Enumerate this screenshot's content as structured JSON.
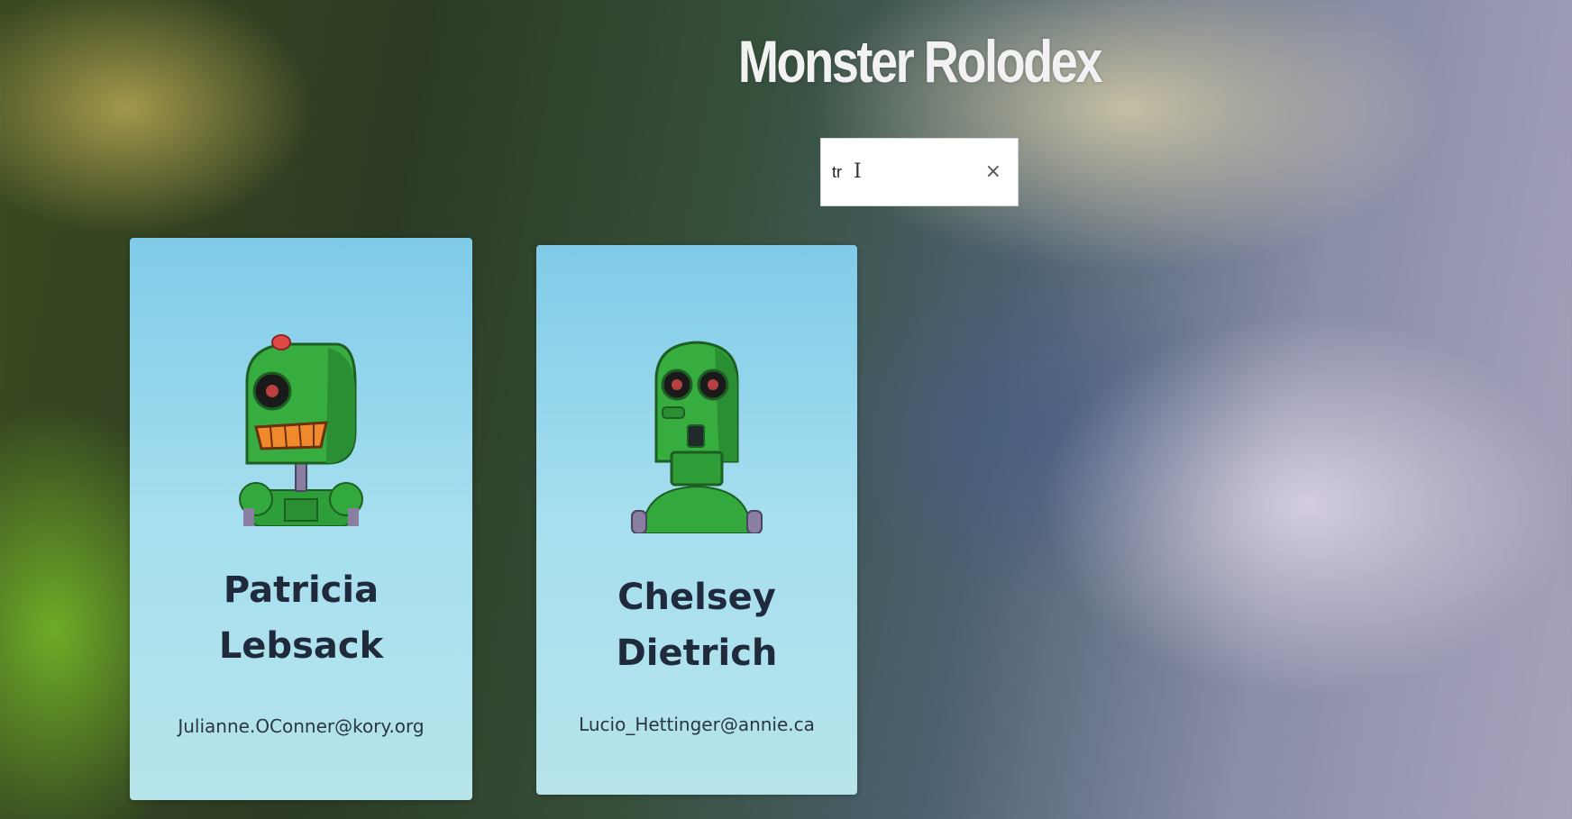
{
  "app": {
    "title": "Monster Rolodex"
  },
  "search": {
    "value": "tr",
    "clear_glyph": "×",
    "cursor_glyph": "I"
  },
  "monsters": [
    {
      "name": "Patricia Lebsack",
      "email": "Julianne.OConner@kory.org",
      "avatar_icon": "robot-avatar-icon"
    },
    {
      "name": "Chelsey Dietrich",
      "email": "Lucio_Hettinger@annie.ca",
      "avatar_icon": "robot-avatar-icon"
    }
  ],
  "colors": {
    "card_top": "#7fcbe8",
    "card_bottom": "#b6e4ea",
    "robot_green": "#2fa83a",
    "text_dark": "#1f2a3c"
  }
}
